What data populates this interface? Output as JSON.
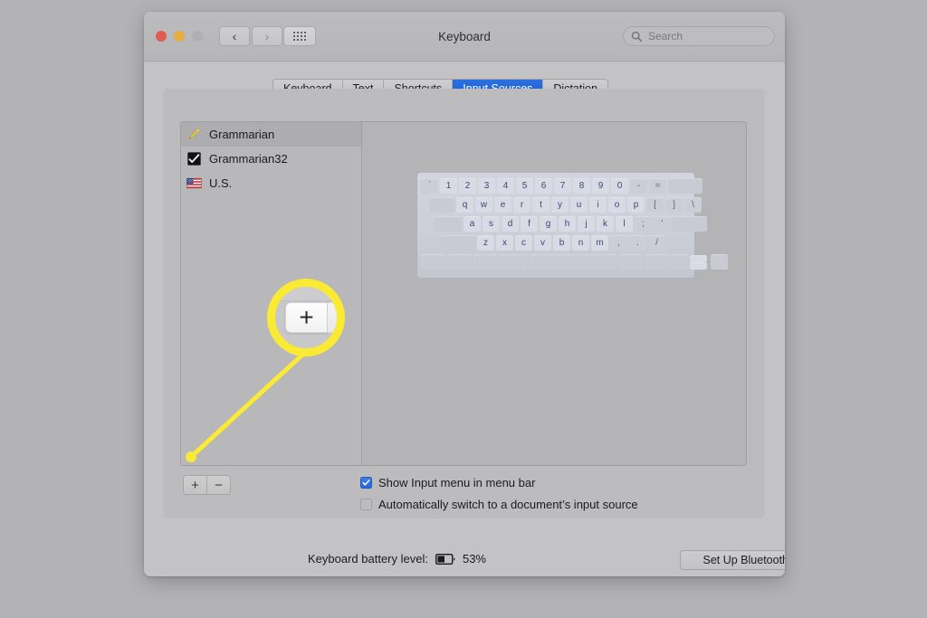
{
  "window": {
    "title": "Keyboard",
    "traffic_lights": [
      "close",
      "minimize",
      "zoom"
    ],
    "nav_back": "‹",
    "nav_forward": "›",
    "grid_icon": "grid-icon"
  },
  "search": {
    "placeholder": "Search",
    "value": "",
    "icon": "search-icon"
  },
  "tabs": [
    {
      "label": "Keyboard",
      "active": false
    },
    {
      "label": "Text",
      "active": false
    },
    {
      "label": "Shortcuts",
      "active": false
    },
    {
      "label": "Input Sources",
      "active": true
    },
    {
      "label": "Dictation",
      "active": false
    }
  ],
  "input_sources": [
    {
      "label": "Grammarian",
      "icon": "pencil-icon",
      "selected": true
    },
    {
      "label": "Grammarian32",
      "icon": "black-square-check-icon",
      "selected": false
    },
    {
      "label": "U.S.",
      "icon": "us-flag-icon",
      "selected": false
    }
  ],
  "list_buttons": {
    "add_label": "+",
    "remove_label": "−"
  },
  "keyboard_viewer": {
    "rows": [
      [
        "`",
        "1",
        "2",
        "3",
        "4",
        "5",
        "6",
        "7",
        "8",
        "9",
        "0",
        "-",
        "="
      ],
      [
        "q",
        "w",
        "e",
        "r",
        "t",
        "y",
        "u",
        "i",
        "o",
        "p",
        "[",
        "]",
        "\\"
      ],
      [
        "a",
        "s",
        "d",
        "f",
        "g",
        "h",
        "j",
        "k",
        "l",
        ";",
        "'"
      ],
      [
        "z",
        "x",
        "c",
        "v",
        "b",
        "n",
        "m",
        ",",
        ".",
        "/"
      ]
    ]
  },
  "checkboxes": [
    {
      "label": "Show Input menu in menu bar",
      "checked": true
    },
    {
      "label": "Automatically switch to a document’s input source",
      "checked": false
    }
  ],
  "footer": {
    "battery_label": "Keyboard battery level:",
    "battery_percent": "53%",
    "battery_icon": "battery-half-icon",
    "setup_bluetooth_label": "Set Up Bluetooth Keyboard…",
    "help_label": "?"
  },
  "callout": {
    "highlight_color": "#fbea34",
    "zoomed_button_label": "+",
    "target": "add-input-source-button"
  }
}
